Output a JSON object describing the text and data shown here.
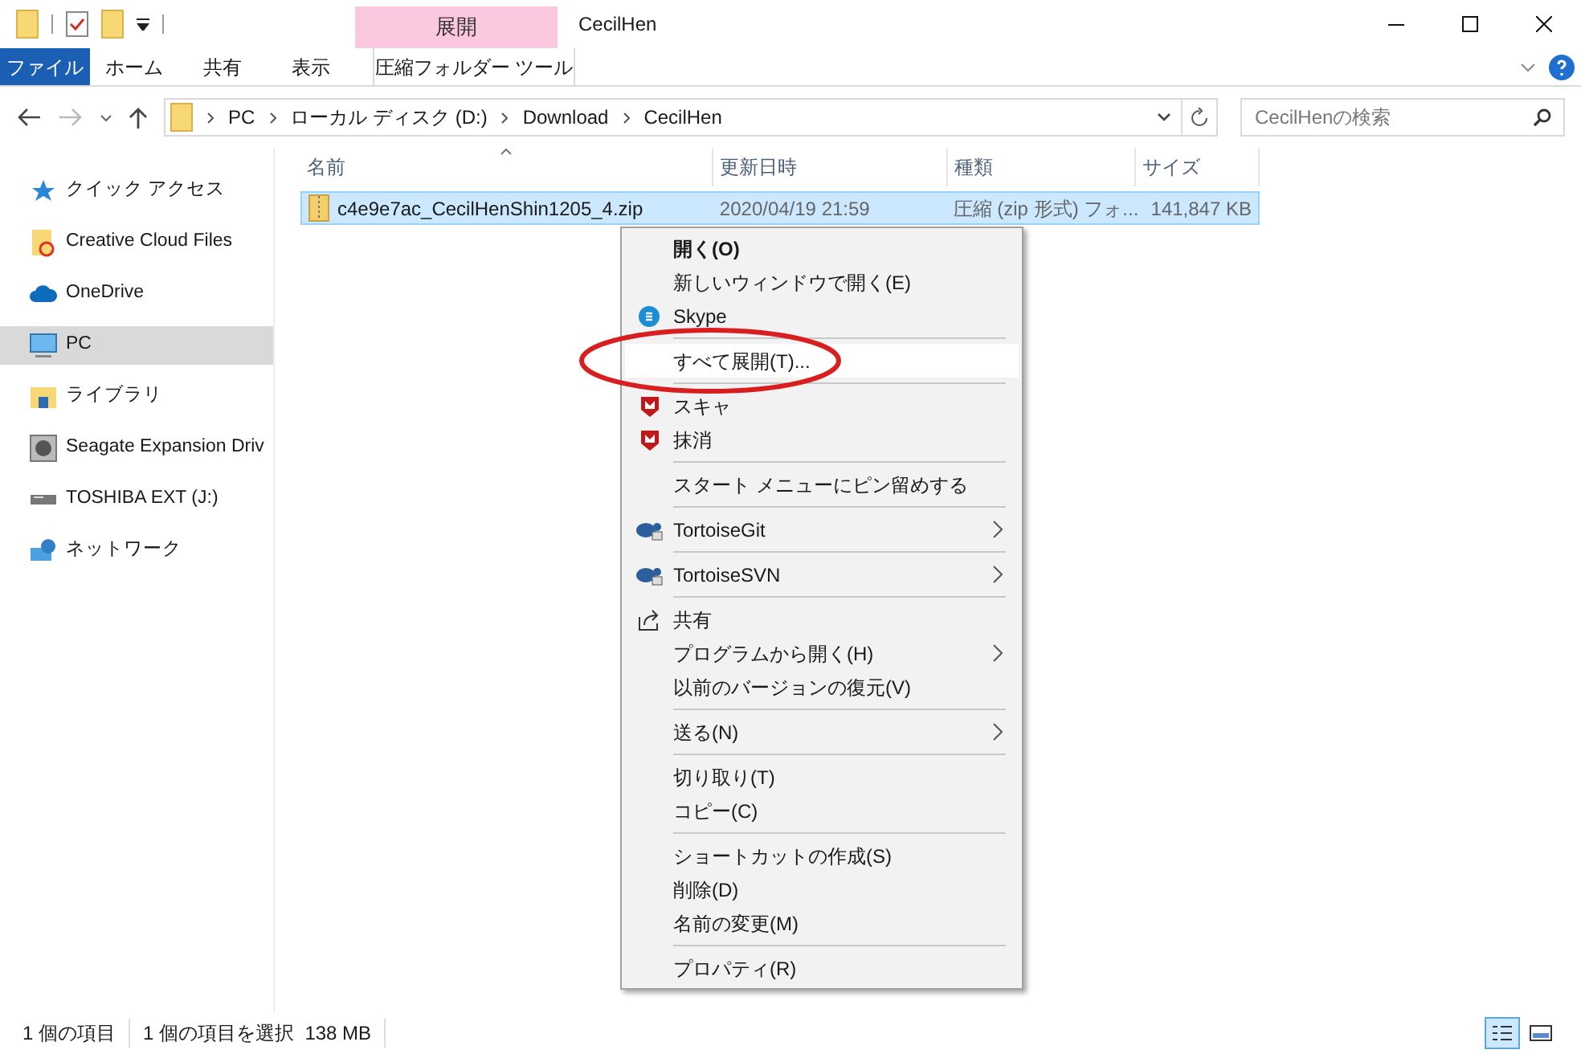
{
  "title_bar": {
    "context_tab": "展開",
    "title": "CecilHen"
  },
  "ribbon_tabs": [
    {
      "label": "ファイル",
      "kind": "file",
      "selected": false
    },
    {
      "label": "ホーム",
      "kind": "tab",
      "selected": false
    },
    {
      "label": "共有",
      "kind": "tab",
      "selected": false
    },
    {
      "label": "表示",
      "kind": "tab",
      "selected": false
    },
    {
      "label": "圧縮フォルダー ツール",
      "kind": "context",
      "selected": false
    }
  ],
  "address_bar": {
    "crumbs": [
      "PC",
      "ローカル ディスク (D:)",
      "Download",
      "CecilHen"
    ]
  },
  "search": {
    "placeholder": "CecilHenの検索"
  },
  "sidebar": {
    "items": [
      {
        "label": "クイック アクセス",
        "selected": false
      },
      {
        "label": "Creative Cloud Files",
        "selected": false
      },
      {
        "label": "OneDrive",
        "selected": false
      },
      {
        "label": "PC",
        "selected": true
      },
      {
        "label": "ライブラリ",
        "selected": false
      },
      {
        "label": "Seagate Expansion Driv",
        "selected": false
      },
      {
        "label": "TOSHIBA EXT (J:)",
        "selected": false
      },
      {
        "label": "ネットワーク",
        "selected": false
      }
    ]
  },
  "table": {
    "columns": [
      "名前",
      "更新日時",
      "種類",
      "サイズ"
    ],
    "rows": [
      {
        "name": "c4e9e7ac_CecilHenShin1205_4.zip",
        "date": "2020/04/19 21:59",
        "type": "圧縮 (zip 形式) フォ...",
        "size": "141,847 KB",
        "selected": true
      }
    ]
  },
  "context_menu": {
    "items": [
      {
        "kind": "item",
        "label": "開く(O)",
        "bold": true,
        "submenu": false,
        "selected": false
      },
      {
        "kind": "item",
        "label": "新しいウィンドウで開く(E)",
        "bold": false,
        "submenu": false,
        "selected": false
      },
      {
        "kind": "item",
        "label": "Skype",
        "bold": false,
        "submenu": false,
        "selected": false
      },
      {
        "kind": "separator"
      },
      {
        "kind": "item",
        "label": "すべて展開(T)...",
        "bold": false,
        "submenu": false,
        "selected": true
      },
      {
        "kind": "separator"
      },
      {
        "kind": "item",
        "label": "スキャ",
        "bold": false,
        "submenu": false,
        "selected": false
      },
      {
        "kind": "item",
        "label": "抹消",
        "bold": false,
        "submenu": false,
        "selected": false
      },
      {
        "kind": "separator"
      },
      {
        "kind": "item",
        "label": "スタート メニューにピン留めする",
        "bold": false,
        "submenu": false,
        "selected": false
      },
      {
        "kind": "separator"
      },
      {
        "kind": "item",
        "label": "TortoiseGit",
        "bold": false,
        "submenu": true,
        "selected": false
      },
      {
        "kind": "separator"
      },
      {
        "kind": "item",
        "label": "TortoiseSVN",
        "bold": false,
        "submenu": true,
        "selected": false
      },
      {
        "kind": "separator"
      },
      {
        "kind": "item",
        "label": "共有",
        "bold": false,
        "submenu": false,
        "selected": false
      },
      {
        "kind": "item",
        "label": "プログラムから開く(H)",
        "bold": false,
        "submenu": true,
        "selected": false
      },
      {
        "kind": "item",
        "label": "以前のバージョンの復元(V)",
        "bold": false,
        "submenu": false,
        "selected": false
      },
      {
        "kind": "separator"
      },
      {
        "kind": "item",
        "label": "送る(N)",
        "bold": false,
        "submenu": true,
        "selected": false
      },
      {
        "kind": "separator"
      },
      {
        "kind": "item",
        "label": "切り取り(T)",
        "bold": false,
        "submenu": false,
        "selected": false
      },
      {
        "kind": "item",
        "label": "コピー(C)",
        "bold": false,
        "submenu": false,
        "selected": false
      },
      {
        "kind": "separator"
      },
      {
        "kind": "item",
        "label": "ショートカットの作成(S)",
        "bold": false,
        "submenu": false,
        "selected": false
      },
      {
        "kind": "item",
        "label": "削除(D)",
        "bold": false,
        "submenu": false,
        "selected": false
      },
      {
        "kind": "item",
        "label": "名前の変更(M)",
        "bold": false,
        "submenu": false,
        "selected": false
      },
      {
        "kind": "separator"
      },
      {
        "kind": "item",
        "label": "プロパティ(R)",
        "bold": false,
        "submenu": false,
        "selected": false
      }
    ]
  },
  "status_bar": {
    "count": "1 個の項目",
    "selection": "1 個の項目を選択  138 MB",
    "view": [
      {
        "kind": "details",
        "selected": true
      },
      {
        "kind": "tiles",
        "selected": false
      }
    ]
  }
}
